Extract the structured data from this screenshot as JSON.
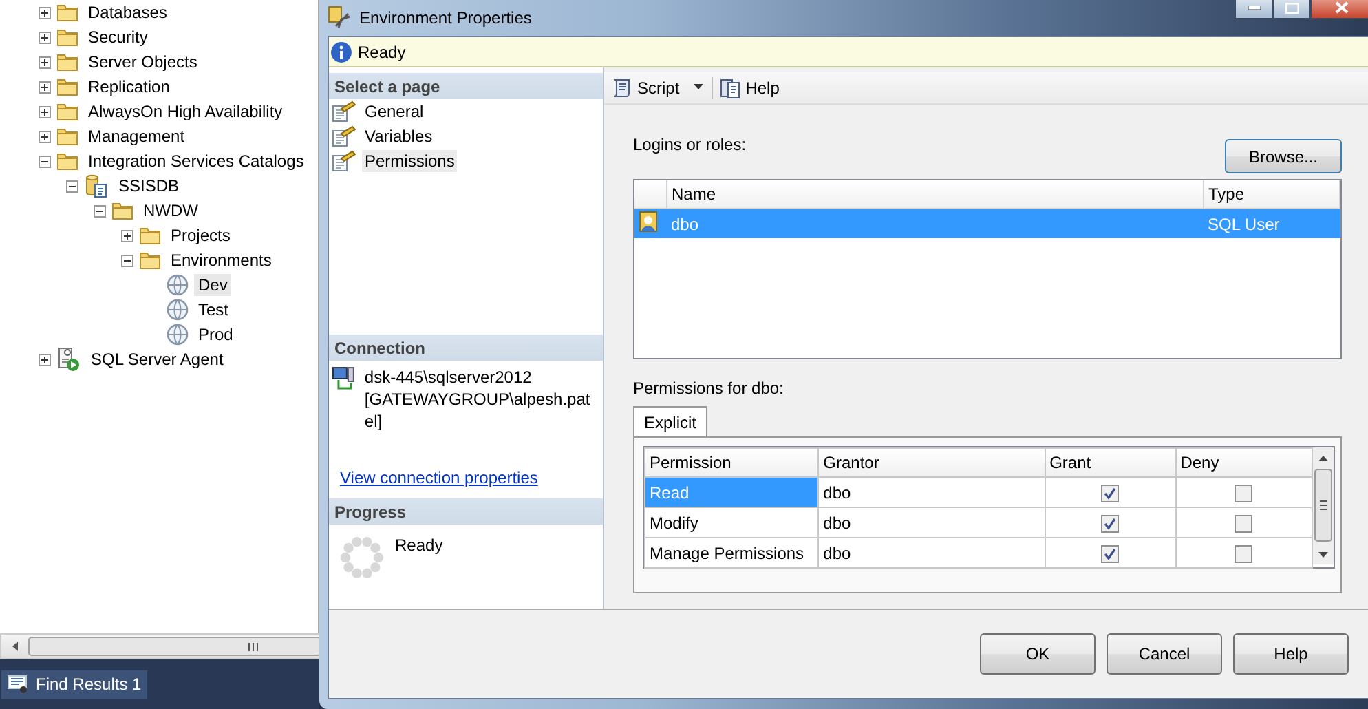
{
  "explorer": {
    "tree": [
      {
        "label": "Databases",
        "kind": "folder",
        "expanded": false,
        "selected": false
      },
      {
        "label": "Security",
        "kind": "folder",
        "expanded": false,
        "selected": false
      },
      {
        "label": "Server Objects",
        "kind": "folder",
        "expanded": false,
        "selected": false
      },
      {
        "label": "Replication",
        "kind": "folder",
        "expanded": false,
        "selected": false
      },
      {
        "label": "AlwaysOn High Availability",
        "kind": "folder",
        "expanded": false,
        "selected": false
      },
      {
        "label": "Management",
        "kind": "folder",
        "expanded": false,
        "selected": false
      },
      {
        "label": "Integration Services Catalogs",
        "kind": "folder",
        "expanded": true,
        "selected": false,
        "children": [
          {
            "label": "SSISDB",
            "kind": "database",
            "expanded": true,
            "selected": false,
            "children": [
              {
                "label": "NWDW",
                "kind": "folder",
                "expanded": true,
                "selected": false,
                "children": [
                  {
                    "label": "Projects",
                    "kind": "folder",
                    "expanded": false,
                    "selected": false
                  },
                  {
                    "label": "Environments",
                    "kind": "folder",
                    "expanded": true,
                    "selected": false,
                    "children": [
                      {
                        "label": "Dev",
                        "kind": "environment",
                        "selected": true
                      },
                      {
                        "label": "Test",
                        "kind": "environment",
                        "selected": false
                      },
                      {
                        "label": "Prod",
                        "kind": "environment",
                        "selected": false
                      }
                    ]
                  }
                ]
              }
            ]
          }
        ]
      },
      {
        "label": "SQL Server Agent",
        "kind": "agent",
        "expanded": false,
        "selected": false
      }
    ],
    "taskbar": [
      {
        "label": "Find Results 1"
      }
    ]
  },
  "dialog": {
    "title": "Environment Properties",
    "status": "Ready",
    "pages": {
      "heading": "Select a page",
      "items": [
        {
          "label": "General",
          "selected": false
        },
        {
          "label": "Variables",
          "selected": false
        },
        {
          "label": "Permissions",
          "selected": true
        }
      ]
    },
    "connection": {
      "heading": "Connection",
      "server": "dsk-445\\sqlserver2012",
      "login": "[GATEWAYGROUP\\alpesh.patel]",
      "link": "View connection properties"
    },
    "progress": {
      "heading": "Progress",
      "status": "Ready"
    },
    "toolbar": [
      {
        "label": "Script",
        "kind": "dropdown"
      },
      {
        "label": "Help",
        "kind": "help"
      }
    ],
    "logins": {
      "label": "Logins or roles:",
      "browse": "Browse...",
      "columns": [
        "Name",
        "Type"
      ],
      "rows": [
        {
          "name": "dbo",
          "type": "SQL User",
          "selected": true
        }
      ]
    },
    "permissions": {
      "label": "Permissions for dbo:",
      "tabs": [
        {
          "label": "Explicit",
          "selected": true
        }
      ],
      "columns": [
        "Permission",
        "Grantor",
        "Grant",
        "Deny"
      ],
      "rows": [
        {
          "permission": "Read",
          "grantor": "dbo",
          "grant": true,
          "deny": false,
          "selected": true
        },
        {
          "permission": "Modify",
          "grantor": "dbo",
          "grant": true,
          "deny": false,
          "selected": false
        },
        {
          "permission": "Manage Permissions",
          "grantor": "dbo",
          "grant": true,
          "deny": false,
          "selected": false
        }
      ]
    },
    "buttons": [
      "OK",
      "Cancel",
      "Help"
    ]
  }
}
